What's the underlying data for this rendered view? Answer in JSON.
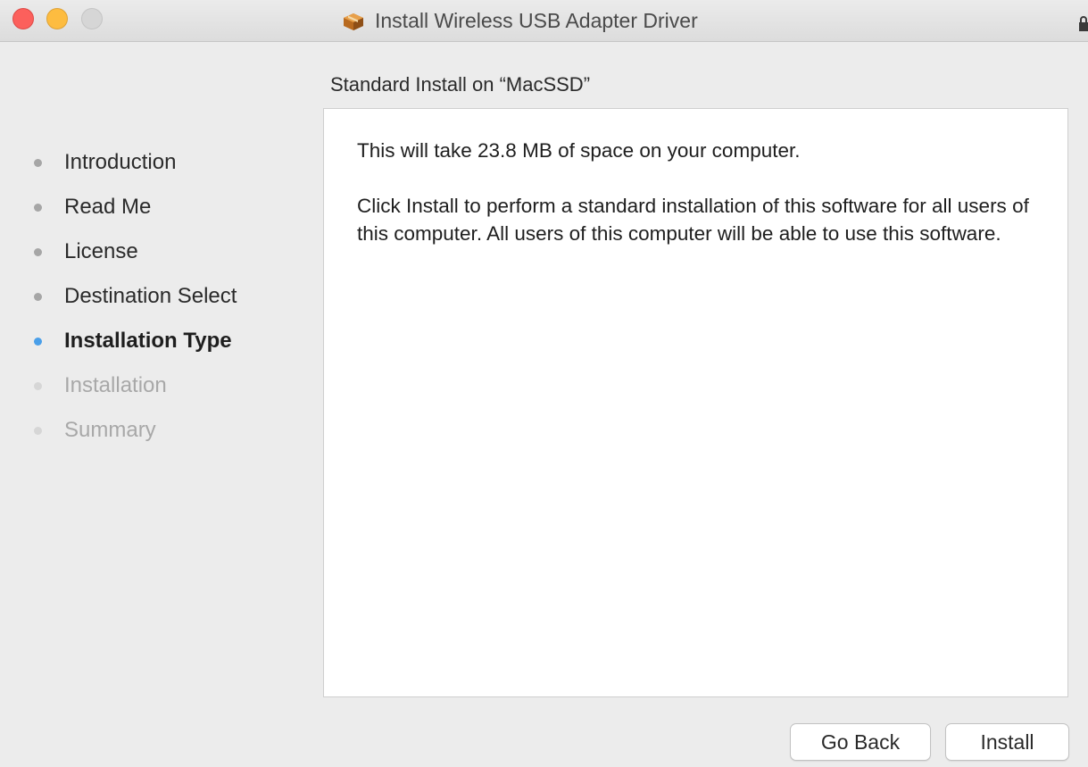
{
  "window": {
    "title": "Install Wireless USB Adapter Driver"
  },
  "sidebar": {
    "steps": [
      {
        "label": "Introduction",
        "state": "done"
      },
      {
        "label": "Read Me",
        "state": "done"
      },
      {
        "label": "License",
        "state": "done"
      },
      {
        "label": "Destination Select",
        "state": "done"
      },
      {
        "label": "Installation Type",
        "state": "current"
      },
      {
        "label": "Installation",
        "state": "future"
      },
      {
        "label": "Summary",
        "state": "future"
      }
    ]
  },
  "main": {
    "heading": "Standard Install on “MacSSD”",
    "space_text": "This will take 23.8 MB of space on your computer.",
    "description": "Click Install to perform a standard installation of this software for all users of this computer. All users of this computer will be able to use this software."
  },
  "buttons": {
    "back_label": "Go Back",
    "install_label": "Install"
  },
  "colors": {
    "current_step_dot": "#4a9fe9",
    "close": "#fc605c",
    "minimize": "#fdbc40"
  }
}
